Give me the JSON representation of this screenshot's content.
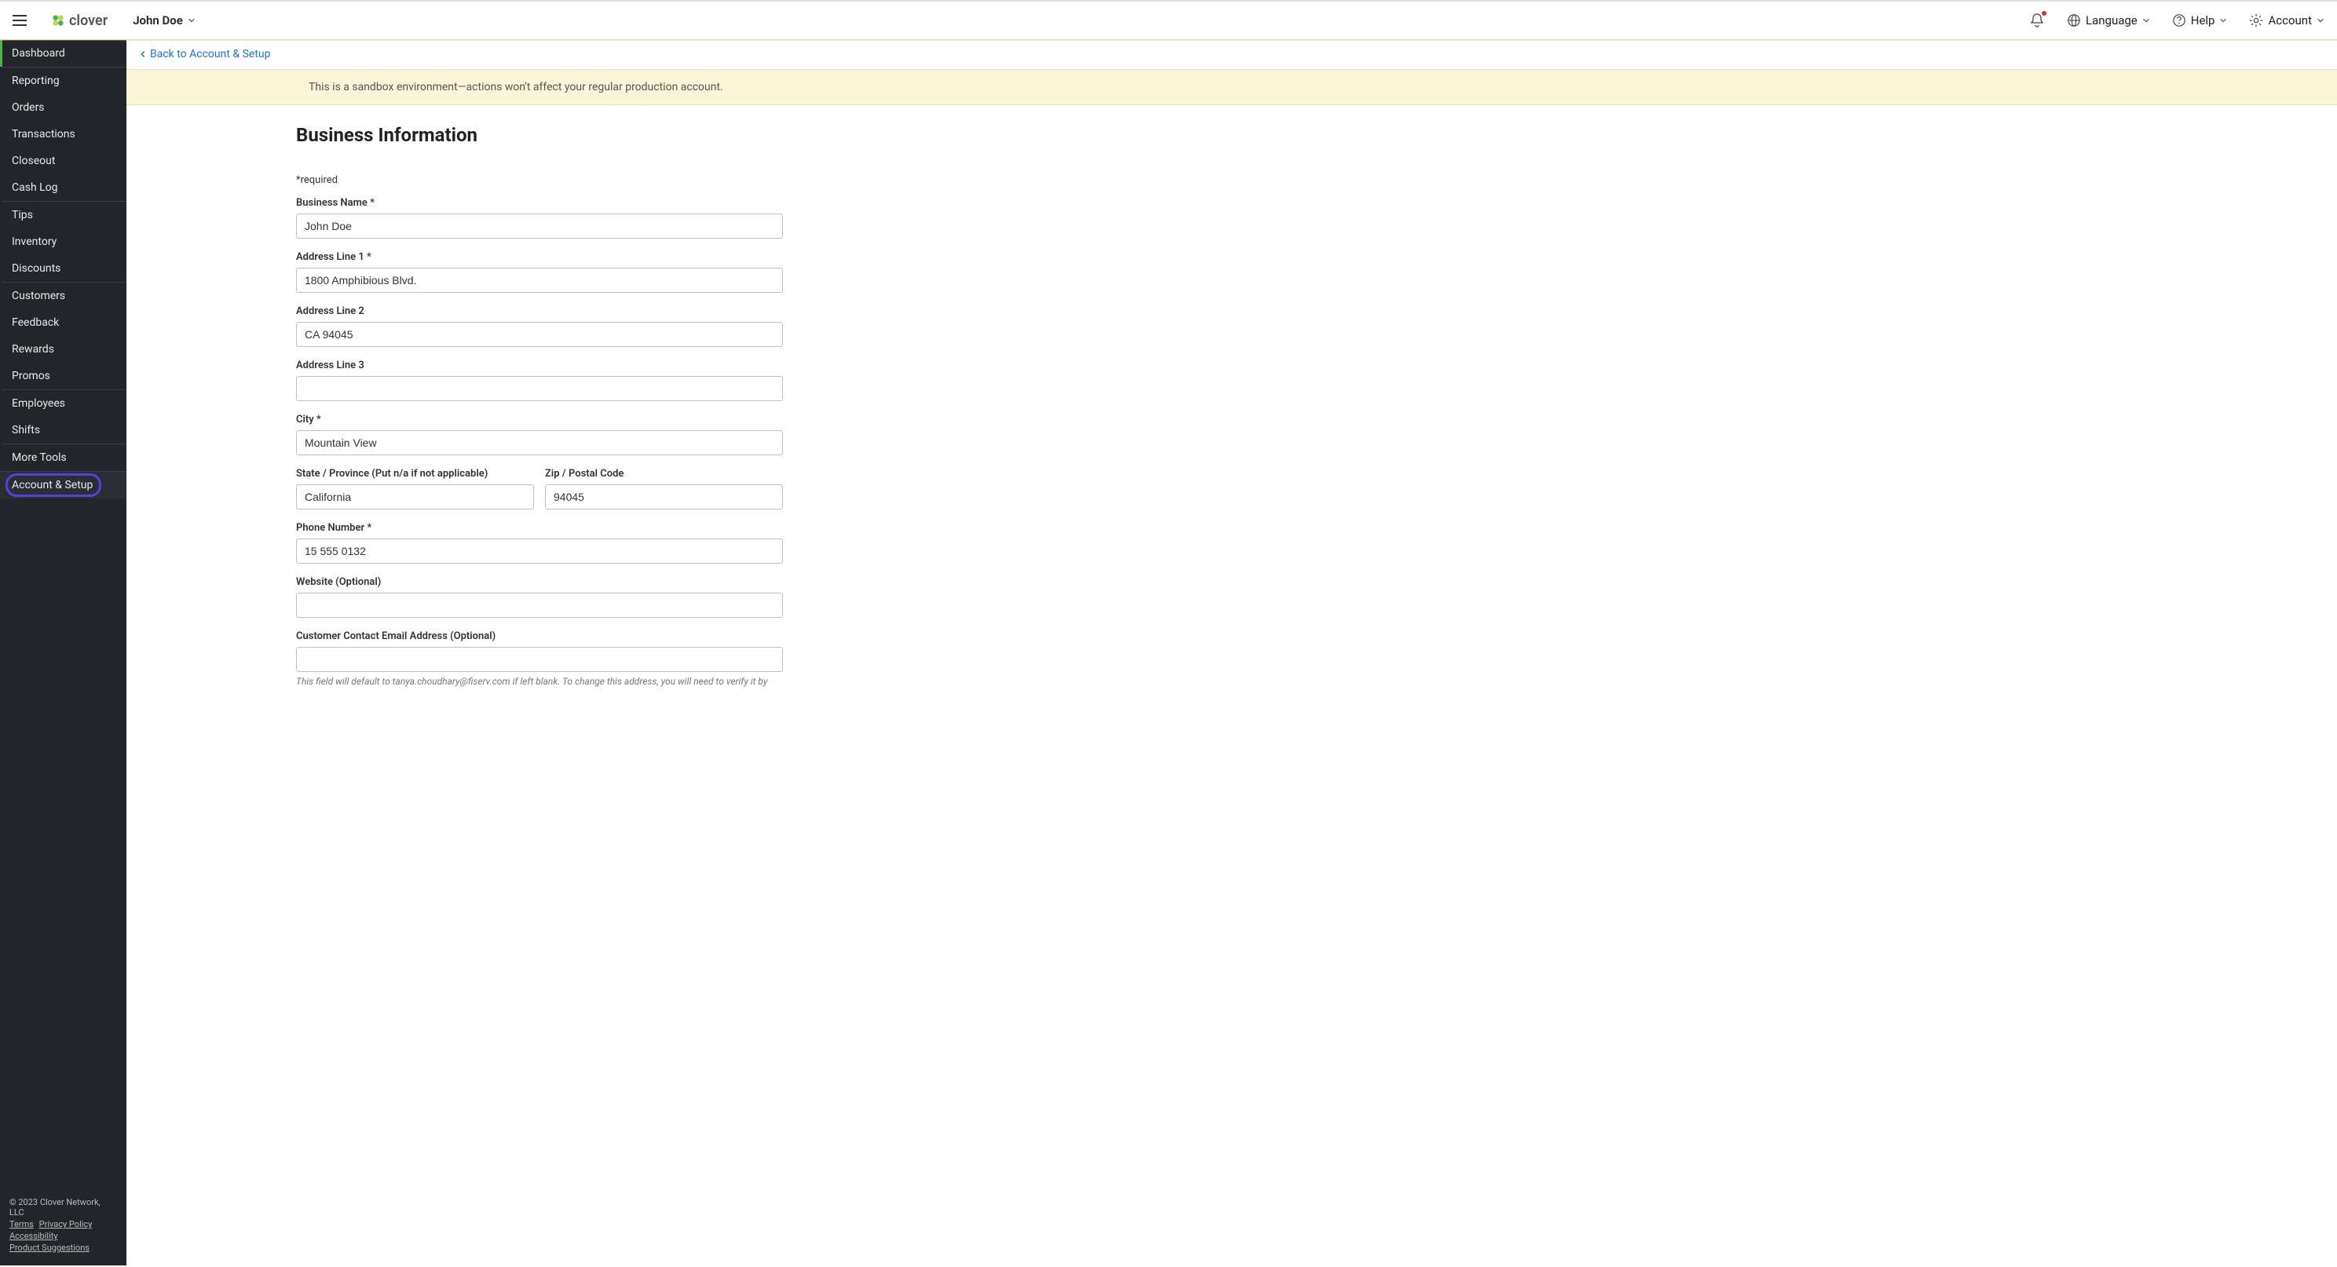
{
  "header": {
    "logo_text": "clover",
    "merchant_name": "John Doe",
    "language_label": "Language",
    "help_label": "Help",
    "account_label": "Account"
  },
  "sidebar": {
    "items": [
      {
        "label": "Dashboard"
      },
      {
        "label": "Reporting"
      },
      {
        "label": "Orders"
      },
      {
        "label": "Transactions"
      },
      {
        "label": "Closeout"
      },
      {
        "label": "Cash Log"
      },
      {
        "label": "Tips"
      },
      {
        "label": "Inventory"
      },
      {
        "label": "Discounts"
      },
      {
        "label": "Customers"
      },
      {
        "label": "Feedback"
      },
      {
        "label": "Rewards"
      },
      {
        "label": "Promos"
      },
      {
        "label": "Employees"
      },
      {
        "label": "Shifts"
      },
      {
        "label": "More Tools"
      },
      {
        "label": "Account & Setup"
      }
    ],
    "footer": {
      "copyright": "© 2023 Clover Network, LLC",
      "terms": "Terms",
      "privacy": "Privacy Policy",
      "accessibility": "Accessibility",
      "suggestions": "Product Suggestions"
    }
  },
  "breadcrumb": {
    "back_label": "Back to Account & Setup"
  },
  "banner": {
    "sandbox_message": "This is a sandbox environment—actions won't affect your regular production account."
  },
  "page": {
    "title": "Business Information",
    "required_note": "*required"
  },
  "form": {
    "business_name": {
      "label": "Business Name *",
      "value": "John Doe"
    },
    "address1": {
      "label": "Address Line 1 *",
      "value": "1800 Amphibious Blvd."
    },
    "address2": {
      "label": "Address Line 2",
      "value": "CA 94045"
    },
    "address3": {
      "label": "Address Line 3",
      "value": ""
    },
    "city": {
      "label": "City *",
      "value": "Mountain View"
    },
    "state": {
      "label": "State / Province (Put n/a if not applicable)",
      "value": "California"
    },
    "zip": {
      "label": "Zip / Postal Code",
      "value": "94045"
    },
    "phone": {
      "label": "Phone Number *",
      "value": "15 555 0132"
    },
    "website": {
      "label": "Website (Optional)",
      "value": ""
    },
    "email": {
      "label": "Customer Contact Email Address (Optional)",
      "value": "",
      "hint": "This field will default to tanya.choudhary@fiserv.com if left blank. To change this address, you will need to verify it by"
    }
  }
}
